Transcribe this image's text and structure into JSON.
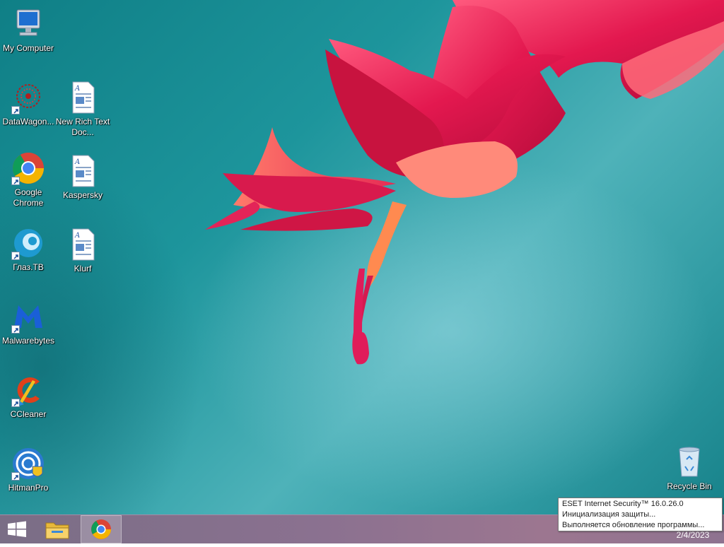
{
  "desktop": {
    "icons": [
      {
        "label": "My Computer",
        "icon": "computer-icon"
      },
      {
        "label": "DataWagon...",
        "icon": "datawagon-icon"
      },
      {
        "label": "New Rich Text Doc...",
        "icon": "rtf-document-icon"
      },
      {
        "label": "Google Chrome",
        "icon": "chrome-icon"
      },
      {
        "label": "Kaspersky",
        "icon": "rtf-document-icon"
      },
      {
        "label": "Глаз.ТВ",
        "icon": "glaz-tv-icon"
      },
      {
        "label": "Klurf",
        "icon": "rtf-document-icon"
      },
      {
        "label": "Malwarebytes",
        "icon": "malwarebytes-icon"
      },
      {
        "label": "CCleaner",
        "icon": "ccleaner-icon"
      },
      {
        "label": "HitmanPro",
        "icon": "hitmanpro-icon"
      },
      {
        "label": "Recycle Bin",
        "icon": "recycle-bin-icon"
      }
    ]
  },
  "taskbar": {
    "pinned": [
      {
        "name": "File Explorer",
        "icon": "file-explorer-icon"
      },
      {
        "name": "Google Chrome",
        "icon": "chrome-icon",
        "active": true
      }
    ],
    "start_icon": "windows-logo-icon",
    "clock_date": "2/4/2023"
  },
  "notification": {
    "title": "ESET Internet Security™ 16.0.26.0",
    "line1": "Инициализация защиты...",
    "line2": "Выполняется обновление программы..."
  },
  "colors": {
    "wallpaper": "#1d959c",
    "taskbar": "#8b7190",
    "flower": "#e0245e"
  }
}
